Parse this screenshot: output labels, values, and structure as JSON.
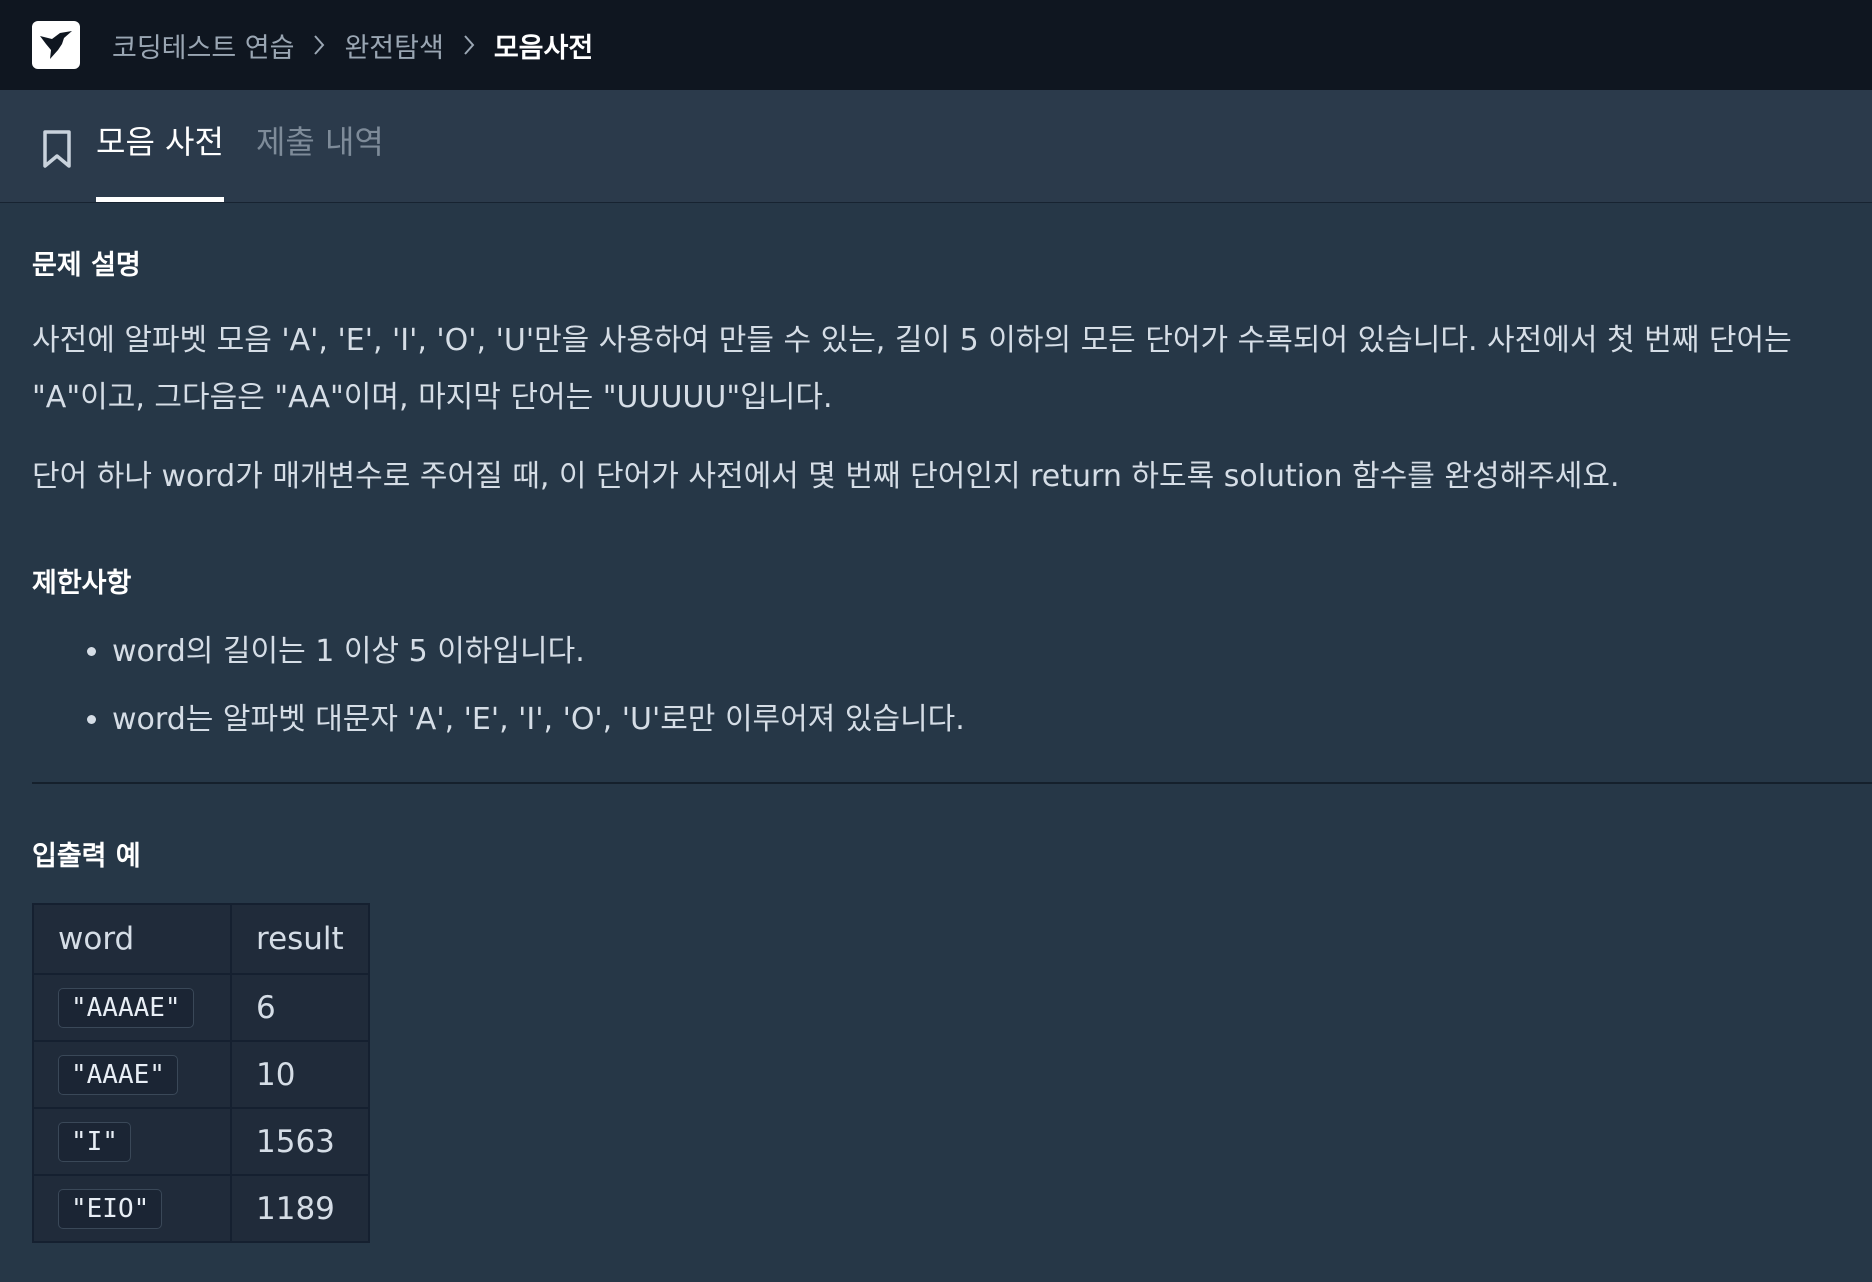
{
  "header": {
    "logo_icon": "hummingbird-logo-icon",
    "breadcrumbs": [
      "코딩테스트 연습",
      "완전탐색",
      "모음사전"
    ]
  },
  "tabs": {
    "bookmark_icon": "bookmark-icon",
    "active": "모음 사전",
    "inactive": "제출 내역"
  },
  "problem": {
    "section_title": "문제 설명",
    "paragraph1": "사전에 알파벳 모음 'A', 'E', 'I', 'O', 'U'만을 사용하여 만들 수 있는, 길이 5 이하의 모든 단어가 수록되어 있습니다. 사전에서 첫 번째 단어는 \"A\"이고, 그다음은 \"AA\"이며, 마지막 단어는 \"UUUUU\"입니다.",
    "paragraph2": "단어 하나 word가 매개변수로 주어질 때, 이 단어가 사전에서 몇 번째 단어인지 return 하도록 solution 함수를 완성해주세요."
  },
  "constraints": {
    "title": "제한사항",
    "items": [
      "word의 길이는 1 이상 5 이하입니다.",
      "word는 알파벳 대문자 'A', 'E', 'I', 'O', 'U'로만 이루어져 있습니다."
    ]
  },
  "examples": {
    "title": "입출력 예",
    "headers": [
      "word",
      "result"
    ],
    "rows": [
      {
        "word": "\"AAAAE\"",
        "result": "6"
      },
      {
        "word": "\"AAAE\"",
        "result": "10"
      },
      {
        "word": "\"I\"",
        "result": "1563"
      },
      {
        "word": "\"EIO\"",
        "result": "1189"
      }
    ]
  }
}
